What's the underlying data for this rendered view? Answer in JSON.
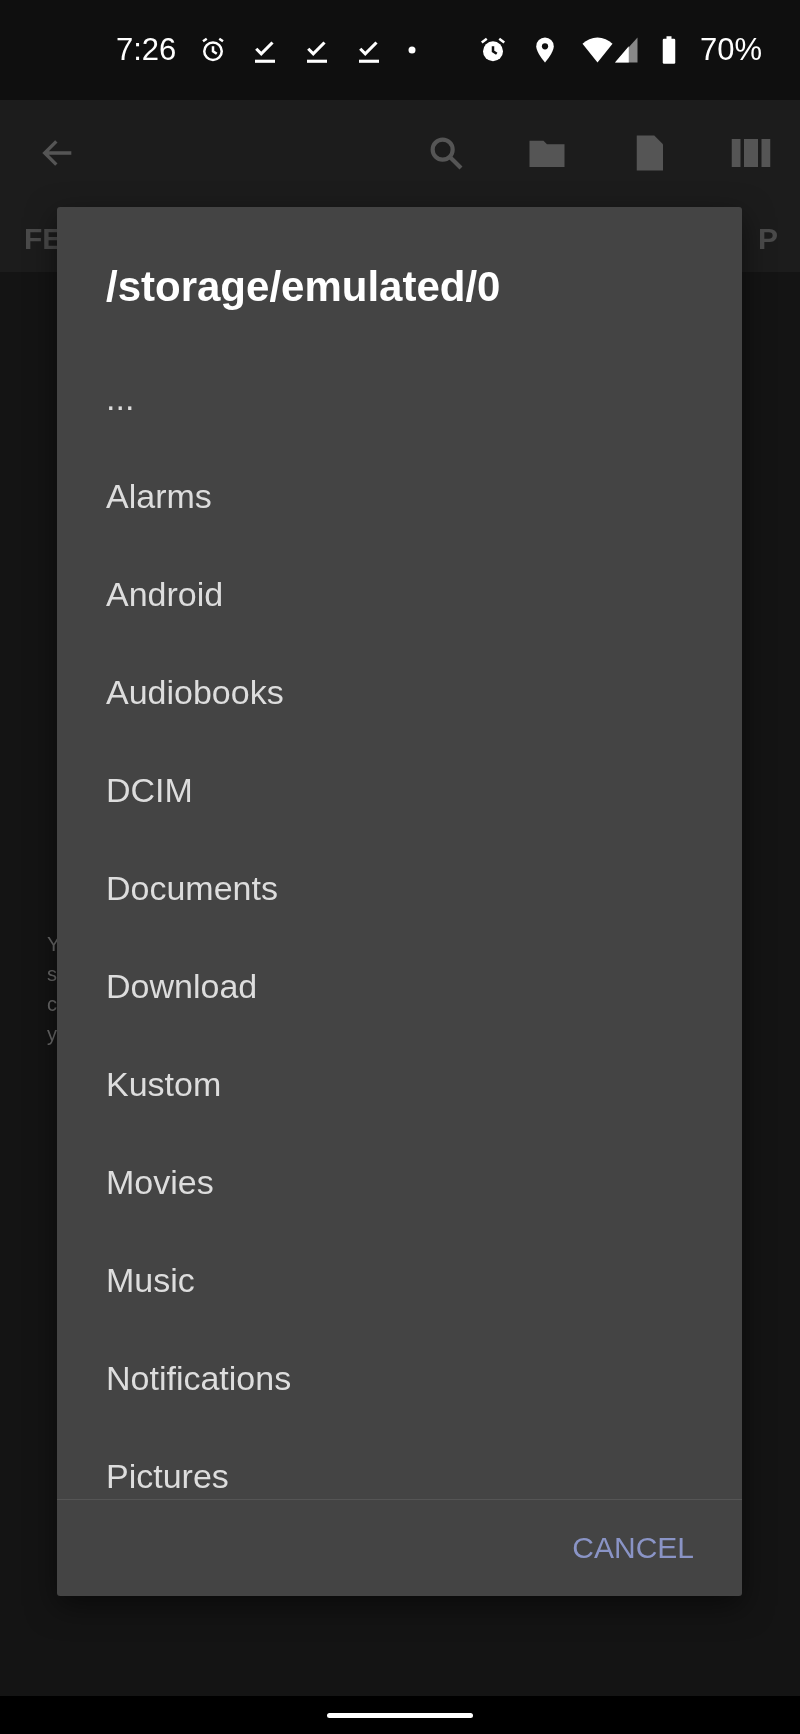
{
  "status_bar": {
    "time": "7:26",
    "battery": "70%"
  },
  "tabs": [
    {
      "label": "FE",
      "selected": false
    },
    {
      "label": "P",
      "selected": false
    }
  ],
  "background_text": [
    "Y",
    "s",
    "c",
    "y"
  ],
  "dialog": {
    "title": "/storage/emulated/0",
    "items": [
      "...",
      "Alarms",
      "Android",
      "Audiobooks",
      "DCIM",
      "Documents",
      "Download",
      "Kustom",
      "Movies",
      "Music",
      "Notifications",
      "Pictures"
    ],
    "buttons": [
      "CANCEL"
    ]
  }
}
